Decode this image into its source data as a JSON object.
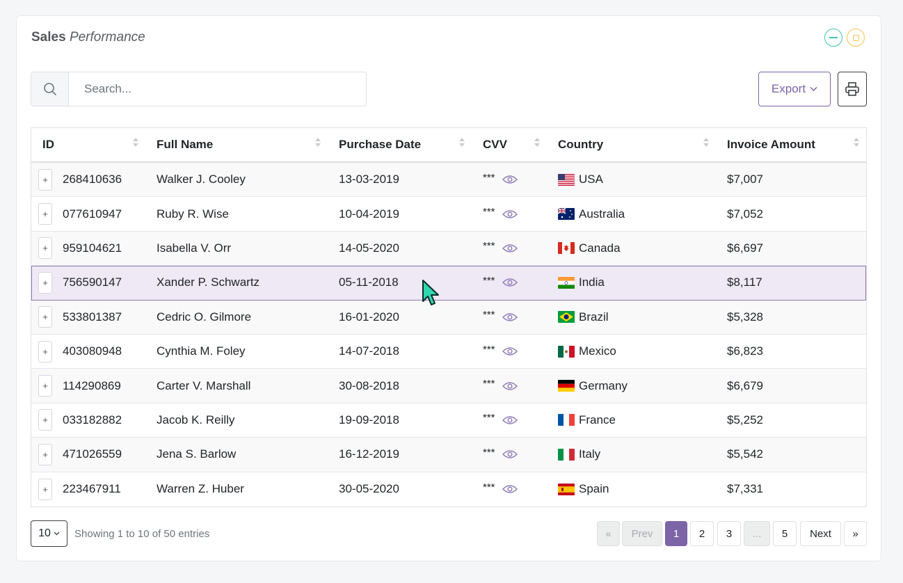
{
  "card": {
    "title_bold": "Sales",
    "title_italic": "Performance"
  },
  "search": {
    "placeholder": "Search..."
  },
  "toolbar": {
    "export_label": "Export"
  },
  "table": {
    "columns": [
      "ID",
      "Full Name",
      "Purchase Date",
      "CVV",
      "Country",
      "Invoice Amount"
    ],
    "rows": [
      {
        "id": "268410636",
        "name": "Walker J. Cooley",
        "date": "13-03-2019",
        "cvv": "***",
        "country": "USA",
        "amount": "$7,007"
      },
      {
        "id": "077610947",
        "name": "Ruby R. Wise",
        "date": "10-04-2019",
        "cvv": "***",
        "country": "Australia",
        "amount": "$7,052"
      },
      {
        "id": "959104621",
        "name": "Isabella V. Orr",
        "date": "14-05-2020",
        "cvv": "***",
        "country": "Canada",
        "amount": "$6,697"
      },
      {
        "id": "756590147",
        "name": "Xander P. Schwartz",
        "date": "05-11-2018",
        "cvv": "***",
        "country": "India",
        "amount": "$8,117"
      },
      {
        "id": "533801387",
        "name": "Cedric O. Gilmore",
        "date": "16-01-2020",
        "cvv": "***",
        "country": "Brazil",
        "amount": "$5,328"
      },
      {
        "id": "403080948",
        "name": "Cynthia M. Foley",
        "date": "14-07-2018",
        "cvv": "***",
        "country": "Mexico",
        "amount": "$6,823"
      },
      {
        "id": "114290869",
        "name": "Carter V. Marshall",
        "date": "30-08-2018",
        "cvv": "***",
        "country": "Germany",
        "amount": "$6,679"
      },
      {
        "id": "033182882",
        "name": "Jacob K. Reilly",
        "date": "19-09-2018",
        "cvv": "***",
        "country": "France",
        "amount": "$5,252"
      },
      {
        "id": "471026559",
        "name": "Jena S. Barlow",
        "date": "16-12-2019",
        "cvv": "***",
        "country": "Italy",
        "amount": "$5,542"
      },
      {
        "id": "223467911",
        "name": "Warren Z. Huber",
        "date": "30-05-2020",
        "cvv": "***",
        "country": "Spain",
        "amount": "$7,331"
      }
    ],
    "expand_label": "+"
  },
  "footer": {
    "page_size": "10",
    "info": "Showing 1 to 10 of 50 entries",
    "pagination": {
      "first": "«",
      "prev": "Prev",
      "pages": [
        "1",
        "2",
        "3",
        "...",
        "5"
      ],
      "next": "Next",
      "last": "»"
    }
  },
  "colors": {
    "accent": "#7c64a6",
    "minimize": "#3cc3b4",
    "maximize": "#f2c44d",
    "selected_row": "#eee9f5"
  }
}
